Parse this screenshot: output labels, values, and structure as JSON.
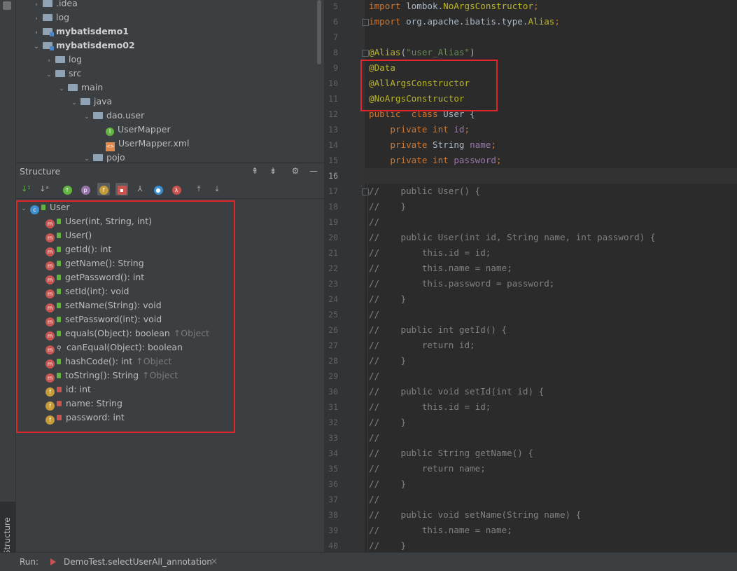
{
  "project_tree": [
    {
      "label": ".idea",
      "indent": 0,
      "expanded": false,
      "type": "folder",
      "bold": false
    },
    {
      "label": "log",
      "indent": 0,
      "expanded": false,
      "type": "folder",
      "bold": false
    },
    {
      "label": "mybatisdemo1",
      "indent": 0,
      "expanded": false,
      "type": "module",
      "bold": true
    },
    {
      "label": "mybatisdemo02",
      "indent": 0,
      "expanded": true,
      "type": "module",
      "bold": true
    },
    {
      "label": "log",
      "indent": 1,
      "expanded": false,
      "type": "folder",
      "bold": false
    },
    {
      "label": "src",
      "indent": 1,
      "expanded": true,
      "type": "folder",
      "bold": false
    },
    {
      "label": "main",
      "indent": 2,
      "expanded": true,
      "type": "folder",
      "bold": false
    },
    {
      "label": "java",
      "indent": 3,
      "expanded": true,
      "type": "folder",
      "bold": false
    },
    {
      "label": "dao.user",
      "indent": 4,
      "expanded": true,
      "type": "folder",
      "bold": false
    },
    {
      "label": "UserMapper",
      "indent": 5,
      "expanded": null,
      "type": "interface",
      "bold": false
    },
    {
      "label": "UserMapper.xml",
      "indent": 5,
      "expanded": null,
      "type": "xml",
      "bold": false
    },
    {
      "label": "pojo",
      "indent": 4,
      "expanded": true,
      "type": "folder",
      "bold": false
    }
  ],
  "structure": {
    "title": "Structure",
    "root": "User",
    "members": [
      {
        "kind": "method",
        "visibility": "public",
        "label": "User(int, String, int)",
        "inherited": ""
      },
      {
        "kind": "method",
        "visibility": "public",
        "label": "User()",
        "inherited": ""
      },
      {
        "kind": "method",
        "visibility": "public",
        "label": "getId(): int",
        "inherited": ""
      },
      {
        "kind": "method",
        "visibility": "public",
        "label": "getName(): String",
        "inherited": ""
      },
      {
        "kind": "method",
        "visibility": "public",
        "label": "getPassword(): int",
        "inherited": ""
      },
      {
        "kind": "method",
        "visibility": "public",
        "label": "setId(int): void",
        "inherited": ""
      },
      {
        "kind": "method",
        "visibility": "public",
        "label": "setName(String): void",
        "inherited": ""
      },
      {
        "kind": "method",
        "visibility": "public",
        "label": "setPassword(int): void",
        "inherited": ""
      },
      {
        "kind": "method",
        "visibility": "public",
        "label": "equals(Object): boolean",
        "inherited": "↑Object"
      },
      {
        "kind": "method",
        "visibility": "protected",
        "label": "canEqual(Object): boolean",
        "inherited": ""
      },
      {
        "kind": "method",
        "visibility": "public",
        "label": "hashCode(): int",
        "inherited": "↑Object"
      },
      {
        "kind": "method",
        "visibility": "public",
        "label": "toString(): String",
        "inherited": "↑Object"
      },
      {
        "kind": "field",
        "visibility": "private",
        "label": "id: int",
        "inherited": ""
      },
      {
        "kind": "field",
        "visibility": "private",
        "label": "name: String",
        "inherited": ""
      },
      {
        "kind": "field",
        "visibility": "private",
        "label": "password: int",
        "inherited": ""
      }
    ]
  },
  "sidebar_tab": "Structure",
  "editor": {
    "current_line": 16,
    "lines": [
      {
        "n": 5,
        "tokens": [
          [
            "kw",
            "import "
          ],
          [
            "",
            "lombok."
          ],
          [
            "ann",
            "NoArgsConstructor"
          ],
          [
            "kw",
            ";"
          ]
        ]
      },
      {
        "n": 6,
        "tokens": [
          [
            "kw",
            "import "
          ],
          [
            "",
            "org.apache.ibatis.type."
          ],
          [
            "ann",
            "Alias"
          ],
          [
            "kw",
            ";"
          ]
        ]
      },
      {
        "n": 7,
        "tokens": []
      },
      {
        "n": 8,
        "tokens": [
          [
            "ann",
            "@Alias"
          ],
          [
            "",
            "("
          ],
          [
            "str",
            "\"user_Alias\""
          ],
          [
            "",
            ")"
          ]
        ]
      },
      {
        "n": 9,
        "tokens": [
          [
            "ann",
            "@Data"
          ]
        ]
      },
      {
        "n": 10,
        "tokens": [
          [
            "ann",
            "@AllArgsConstructor"
          ]
        ]
      },
      {
        "n": 11,
        "tokens": [
          [
            "ann",
            "@NoArgsConstructor"
          ]
        ]
      },
      {
        "n": 12,
        "tokens": [
          [
            "kw",
            "public  class "
          ],
          [
            "",
            "User {"
          ]
        ]
      },
      {
        "n": 13,
        "tokens": [
          [
            "",
            "    "
          ],
          [
            "kw",
            "private int "
          ],
          [
            "fld",
            "id"
          ],
          [
            "kw",
            ";"
          ]
        ]
      },
      {
        "n": 14,
        "tokens": [
          [
            "",
            "    "
          ],
          [
            "kw",
            "private "
          ],
          [
            "",
            "String "
          ],
          [
            "fld",
            "name"
          ],
          [
            "kw",
            ";"
          ]
        ]
      },
      {
        "n": 15,
        "tokens": [
          [
            "",
            "    "
          ],
          [
            "kw",
            "private int "
          ],
          [
            "fld",
            "password"
          ],
          [
            "kw",
            ";"
          ]
        ]
      },
      {
        "n": 16,
        "tokens": []
      },
      {
        "n": 17,
        "tokens": [
          [
            "cm",
            "//    public User() {"
          ]
        ]
      },
      {
        "n": 18,
        "tokens": [
          [
            "cm",
            "//    }"
          ]
        ]
      },
      {
        "n": 19,
        "tokens": [
          [
            "cm",
            "//"
          ]
        ]
      },
      {
        "n": 20,
        "tokens": [
          [
            "cm",
            "//    public User(int id, String name, int password) {"
          ]
        ]
      },
      {
        "n": 21,
        "tokens": [
          [
            "cm",
            "//        this.id = id;"
          ]
        ]
      },
      {
        "n": 22,
        "tokens": [
          [
            "cm",
            "//        this.name = name;"
          ]
        ]
      },
      {
        "n": 23,
        "tokens": [
          [
            "cm",
            "//        this.password = password;"
          ]
        ]
      },
      {
        "n": 24,
        "tokens": [
          [
            "cm",
            "//    }"
          ]
        ]
      },
      {
        "n": 25,
        "tokens": [
          [
            "cm",
            "//"
          ]
        ]
      },
      {
        "n": 26,
        "tokens": [
          [
            "cm",
            "//    public int getId() {"
          ]
        ]
      },
      {
        "n": 27,
        "tokens": [
          [
            "cm",
            "//        return id;"
          ]
        ]
      },
      {
        "n": 28,
        "tokens": [
          [
            "cm",
            "//    }"
          ]
        ]
      },
      {
        "n": 29,
        "tokens": [
          [
            "cm",
            "//"
          ]
        ]
      },
      {
        "n": 30,
        "tokens": [
          [
            "cm",
            "//    public void setId(int id) {"
          ]
        ]
      },
      {
        "n": 31,
        "tokens": [
          [
            "cm",
            "//        this.id = id;"
          ]
        ]
      },
      {
        "n": 32,
        "tokens": [
          [
            "cm",
            "//    }"
          ]
        ]
      },
      {
        "n": 33,
        "tokens": [
          [
            "cm",
            "//"
          ]
        ]
      },
      {
        "n": 34,
        "tokens": [
          [
            "cm",
            "//    public String getName() {"
          ]
        ]
      },
      {
        "n": 35,
        "tokens": [
          [
            "cm",
            "//        return name;"
          ]
        ]
      },
      {
        "n": 36,
        "tokens": [
          [
            "cm",
            "//    }"
          ]
        ]
      },
      {
        "n": 37,
        "tokens": [
          [
            "cm",
            "//"
          ]
        ]
      },
      {
        "n": 38,
        "tokens": [
          [
            "cm",
            "//    public void setName(String name) {"
          ]
        ]
      },
      {
        "n": 39,
        "tokens": [
          [
            "cm",
            "//        this.name = name;"
          ]
        ]
      },
      {
        "n": 40,
        "tokens": [
          [
            "cm",
            "//    }"
          ]
        ]
      }
    ]
  },
  "bottom_bar": {
    "run_label": "Run:",
    "tab_label": "DemoTest.selectUserAll_annotation",
    "close_glyph": "×"
  },
  "colors": {
    "highlight_box": "#e0252b",
    "keyword": "#cc7832",
    "annotation": "#bbb529",
    "string": "#6a8759",
    "field": "#9876aa",
    "comment": "#808080"
  }
}
